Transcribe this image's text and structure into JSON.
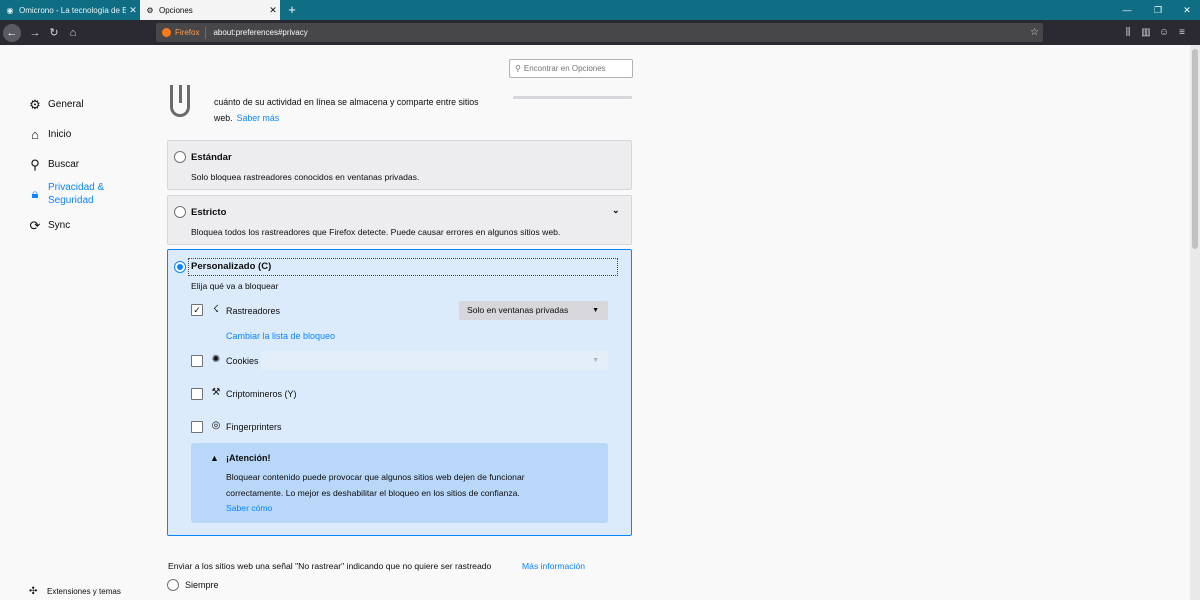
{
  "tabs": [
    {
      "title": "Omicrono - La tecnología de El",
      "icon": "globe-icon"
    },
    {
      "title": "Opciones",
      "icon": "gear-icon"
    }
  ],
  "toolbar": {
    "url_brand": "Firefox",
    "url": "about:preferences#privacy"
  },
  "search": {
    "placeholder": "Encontrar en Opciones"
  },
  "sidebar": {
    "items": [
      {
        "label": "General",
        "icon": "gear-icon"
      },
      {
        "label": "Inicio",
        "icon": "home-icon"
      },
      {
        "label": "Buscar",
        "icon": "search-icon"
      },
      {
        "label": "Privacidad &",
        "label2": "Seguridad",
        "icon": "lock-icon"
      },
      {
        "label": "Sync",
        "icon": "sync-icon"
      }
    ],
    "footer": {
      "label": "Extensiones y temas",
      "icon": "puzzle-icon"
    }
  },
  "intro": {
    "text": "cuánto de su actividad en línea se almacena y comparte entre sitios web.",
    "link": "Saber más"
  },
  "options": {
    "standard": {
      "title": "Estándar",
      "desc": "Solo bloquea rastreadores conocidos en ventanas privadas."
    },
    "strict": {
      "title": "Estricto",
      "desc": "Bloquea todos los rastreadores que Firefox detecte. Puede causar errores en algunos sitios web."
    },
    "custom": {
      "title": "Personalizado (C)",
      "subtitle": "Elija qué va a bloquear",
      "trackers": {
        "label": "Rastreadores",
        "checked": true,
        "select": "Solo en ventanas privadas",
        "link": "Cambiar la lista de bloqueo"
      },
      "cookies": {
        "label": "Cookies",
        "checked": false
      },
      "cryptominers": {
        "label": "Criptomineros (Y)",
        "checked": false
      },
      "fingerprinters": {
        "label": "Fingerprinters",
        "checked": false
      },
      "warning": {
        "title": "¡Atención!",
        "body": "Bloquear contenido puede provocar que algunos sitios web dejen de funcionar correctamente. Lo mejor es deshabilitar el bloqueo en los sitios de confianza.",
        "link": "Saber cómo"
      }
    }
  },
  "dnt": {
    "text": "Enviar a los sitios web una señal \"No rastrear\" indicando que no quiere ser rastreado",
    "link": "Más información",
    "option_always": "Siempre"
  }
}
